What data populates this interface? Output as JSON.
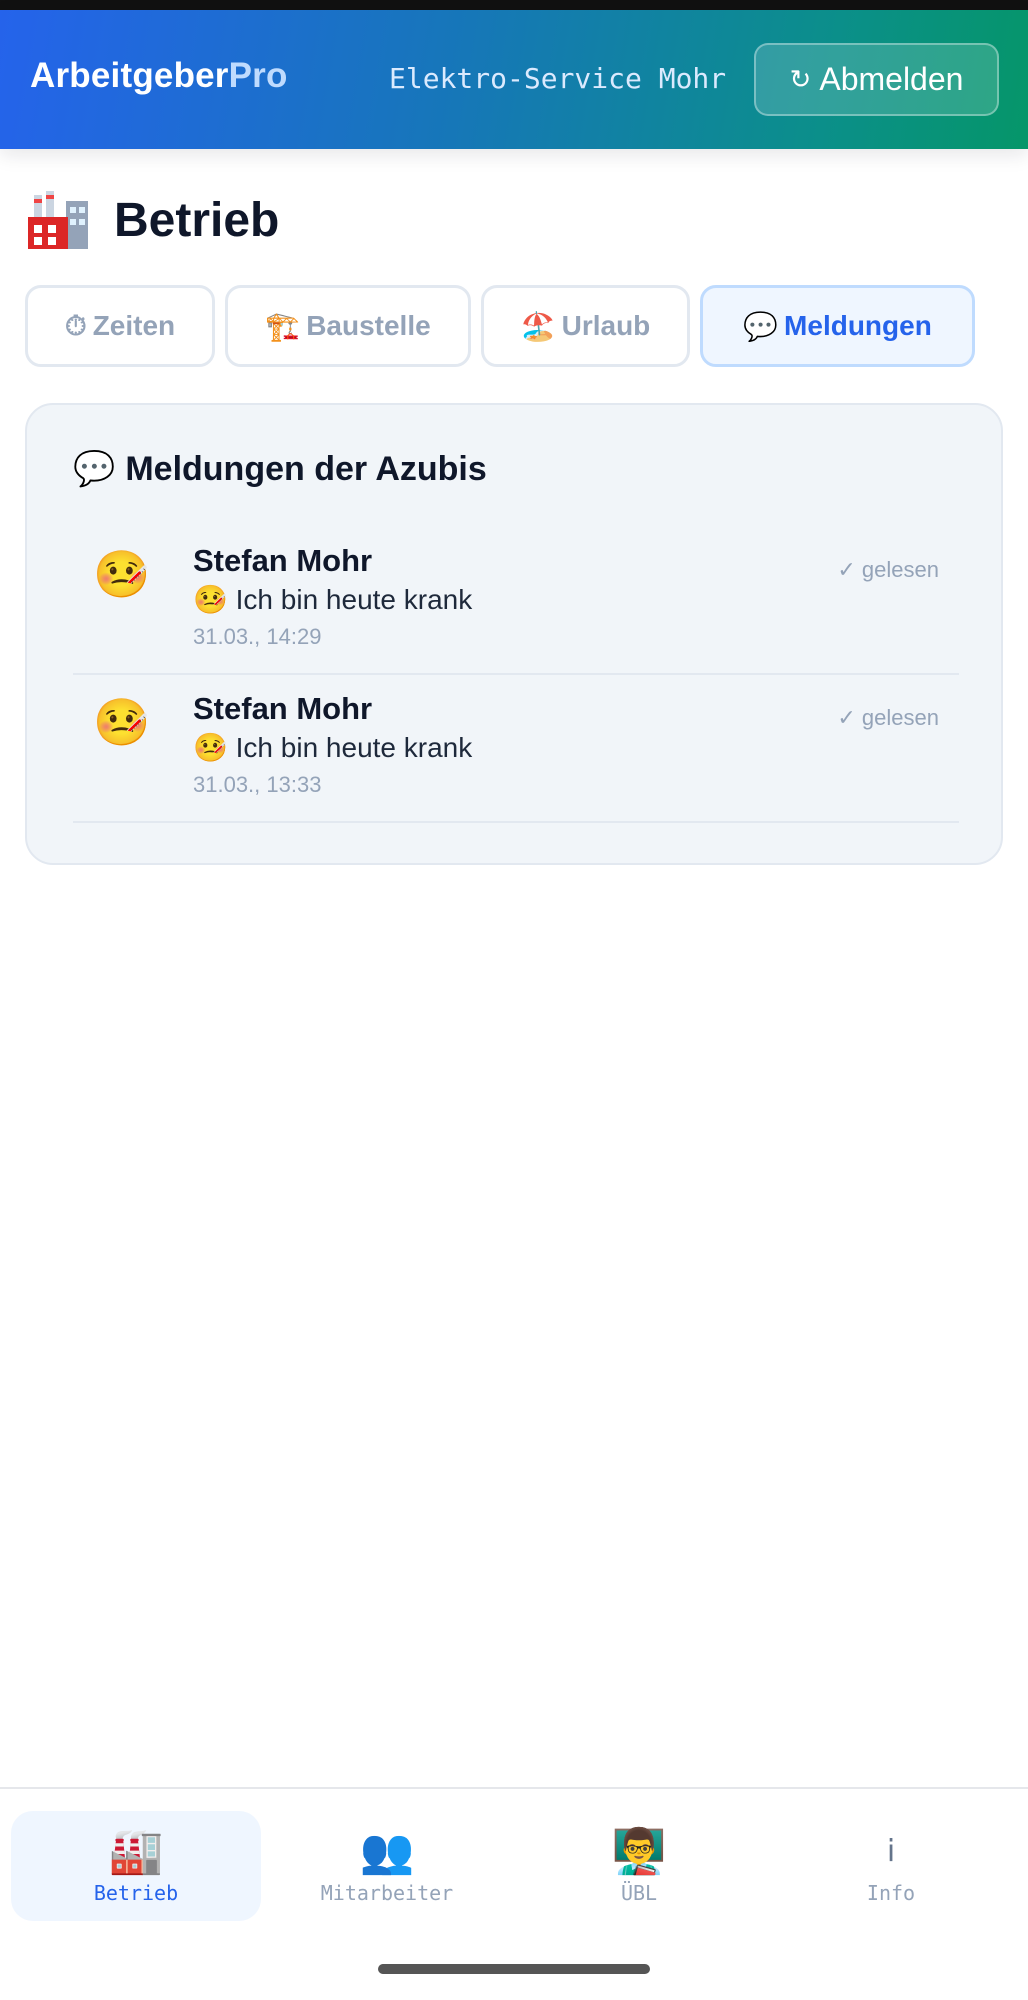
{
  "header": {
    "brand_main": "Arbeitgeber",
    "brand_accent": "Pro",
    "company": "Elektro-Service Mohr",
    "logout_label": "Abmelden",
    "logout_icon": "↻"
  },
  "page": {
    "title": "Betrieb",
    "title_icon": "🏭"
  },
  "tabs": [
    {
      "icon": "⏱",
      "label": "Zeiten",
      "active": false
    },
    {
      "icon": "🏗️",
      "label": "Baustelle",
      "active": false
    },
    {
      "icon": "🏖️",
      "label": "Urlaub",
      "active": false
    },
    {
      "icon": "💬",
      "label": "Meldungen",
      "active": true
    }
  ],
  "messages_card": {
    "title_icon": "💬",
    "title": "Meldungen der Azubis",
    "items": [
      {
        "emoji": "🤒",
        "name": "Stefan Mohr",
        "text": "🤒 Ich bin heute krank",
        "time": "31.03., 14:29",
        "status": "✓ gelesen"
      },
      {
        "emoji": "🤒",
        "name": "Stefan Mohr",
        "text": "🤒 Ich bin heute krank",
        "time": "31.03., 13:33",
        "status": "✓ gelesen"
      }
    ]
  },
  "bottom_nav": [
    {
      "icon": "🏭",
      "label": "Betrieb",
      "active": true
    },
    {
      "icon": "👥",
      "label": "Mitarbeiter",
      "active": false
    },
    {
      "icon": "👨‍🏫",
      "label": "ÜBL",
      "active": false
    },
    {
      "icon": "i",
      "label": "Info",
      "active": false
    }
  ],
  "colors": {
    "accent": "#2563eb",
    "header_gradient_start": "#2563eb",
    "header_gradient_end": "#059669",
    "muted": "#94a3b8"
  }
}
